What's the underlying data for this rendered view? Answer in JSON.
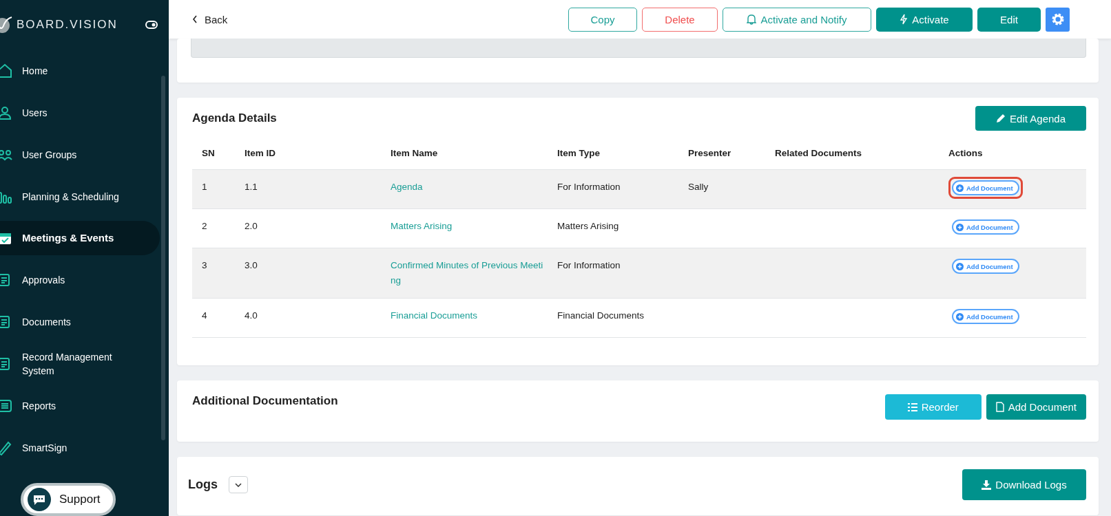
{
  "sidebar": {
    "brand": "BOARD.VISION",
    "items": [
      {
        "label": "Home",
        "kind": "home",
        "selected": false
      },
      {
        "label": "Users",
        "kind": "user",
        "selected": false
      },
      {
        "label": "User Groups",
        "kind": "users",
        "selected": false
      },
      {
        "label": "Planning & Scheduling",
        "kind": "bars",
        "selected": false
      },
      {
        "label": "Meetings & Events",
        "kind": "calendar",
        "selected": true
      },
      {
        "label": "Approvals",
        "kind": "note",
        "selected": false
      },
      {
        "label": "Documents",
        "kind": "docs",
        "selected": false
      },
      {
        "label": "Record Management System",
        "kind": "record",
        "selected": false
      },
      {
        "label": "Reports",
        "kind": "list",
        "selected": false
      },
      {
        "label": "SmartSign",
        "kind": "pen",
        "selected": false
      }
    ],
    "support": "Support"
  },
  "topbar": {
    "back": "Back",
    "buttons": [
      {
        "label": "Copy",
        "kind": "outline"
      },
      {
        "label": "Delete",
        "kind": "danger"
      },
      {
        "label": "Activate and Notify",
        "kind": "bell"
      },
      {
        "label": "Activate",
        "kind": "bolt"
      },
      {
        "label": "Edit",
        "kind": "solid"
      }
    ]
  },
  "agenda": {
    "title": "Agenda Details",
    "edit_button": "Edit Agenda",
    "columns": [
      "SN",
      "Item ID",
      "Item Name",
      "Item Type",
      "Presenter",
      "Related Documents",
      "Actions"
    ],
    "rows": [
      {
        "sn": "1",
        "id": "1.1",
        "name": "Agenda",
        "type": "For Information",
        "presenter": "Sally",
        "action": "Add Document",
        "highlighted": true
      },
      {
        "sn": "2",
        "id": "2.0",
        "name": "Matters Arising",
        "type": "Matters Arising",
        "action": "Add Document",
        "highlighted": false
      },
      {
        "sn": "3",
        "id": "3.0",
        "name": "Confirmed Minutes of Previous Meeting",
        "type": "For Information",
        "action": "Add Document",
        "highlighted": false
      },
      {
        "sn": "4",
        "id": "4.0",
        "name": "Financial Documents",
        "type": "Financial Documents",
        "action": "Add Document",
        "highlighted": false
      }
    ]
  },
  "additional": {
    "title": "Additional Documentation",
    "reorder": "Reorder",
    "add": "Add Document"
  },
  "logs": {
    "title": "Logs",
    "download": "Download Logs"
  }
}
